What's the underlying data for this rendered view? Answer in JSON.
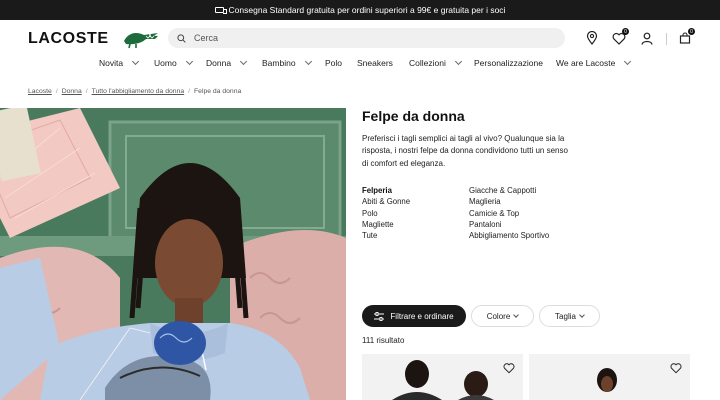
{
  "announcement": {
    "text": "Consegna Standard gratuita per ordini superiori a 99€ e gratuita per i soci"
  },
  "header": {
    "logo": "LACOSTE",
    "search_placeholder": "Cerca",
    "wishlist_count": "0",
    "cart_count": "0"
  },
  "nav": {
    "items": [
      {
        "label": "Novita",
        "has_menu": true
      },
      {
        "label": "Uomo",
        "has_menu": true
      },
      {
        "label": "Donna",
        "has_menu": true
      },
      {
        "label": "Bambino",
        "has_menu": true
      },
      {
        "label": "Polo",
        "has_menu": false
      },
      {
        "label": "Sneakers",
        "has_menu": false
      },
      {
        "label": "Collezioni",
        "has_menu": true
      },
      {
        "label": "Personalizzazione",
        "has_menu": false
      },
      {
        "label": "We are Lacoste",
        "has_menu": true
      }
    ]
  },
  "breadcrumb": {
    "items": [
      "Lacoste",
      "Donna",
      "Tutto l'abbigliamento da donna"
    ],
    "current": "Felpe da donna"
  },
  "main": {
    "title": "Felpe da donna",
    "description": "Preferisci i tagli semplici ai tagli al vivo? Qualunque sia la risposta, i nostri felpe da donna condividono tutti un senso di comfort ed eleganza.",
    "categories": [
      "Felperia",
      "Giacche & Cappotti",
      "Abiti & Gonne",
      "Maglieria",
      "Polo",
      "Camicie & Top",
      "Magliette",
      "Pantaloni",
      "Tute",
      "Abbigliamento Sportivo"
    ],
    "active_category": "Felperia",
    "filter_button": "Filtrare e ordinare",
    "color_filter": "Colore",
    "size_filter": "Taglia",
    "results_count": "111 risultato"
  },
  "colors": {
    "dark": "#1a1a1a",
    "brand_green": "#1d6b3a",
    "sweater_blue": "#b8cce6",
    "wall_green": "#4a7a5e",
    "sofa_pink": "#e4b9b5"
  }
}
